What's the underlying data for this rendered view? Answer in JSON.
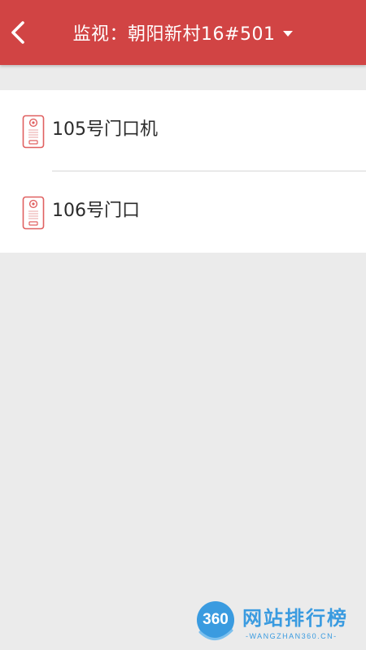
{
  "header": {
    "title": "监视：朝阳新村16#501",
    "back_icon": "chevron-left-icon",
    "dropdown_icon": "caret-down-icon"
  },
  "devices": [
    {
      "label": "105号门口机",
      "icon": "door-intercom-icon"
    },
    {
      "label": "106号门口",
      "icon": "door-intercom-icon"
    }
  ],
  "watermark": {
    "badge": "360",
    "name": "网站排行榜",
    "sub": "-WANGZHAN360.CN-"
  },
  "colors": {
    "header_bg": "#d14444",
    "page_bg": "#ebebeb",
    "icon_accent": "#e06060",
    "watermark": "#3a9be0"
  }
}
